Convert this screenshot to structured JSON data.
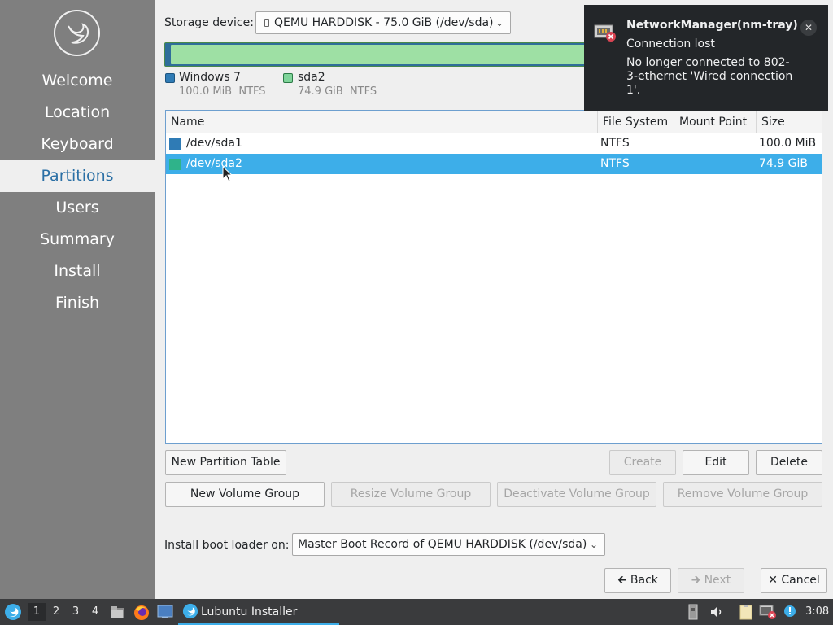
{
  "sidebar": {
    "items": [
      {
        "label": "Welcome",
        "active": false
      },
      {
        "label": "Location",
        "active": false
      },
      {
        "label": "Keyboard",
        "active": false
      },
      {
        "label": "Partitions",
        "active": true
      },
      {
        "label": "Users",
        "active": false
      },
      {
        "label": "Summary",
        "active": false
      },
      {
        "label": "Install",
        "active": false
      },
      {
        "label": "Finish",
        "active": false
      }
    ]
  },
  "storage": {
    "label": "Storage device:",
    "device": "QEMU HARDDISK - 75.0 GiB (/dev/sda)"
  },
  "legend": [
    {
      "name": "Windows 7",
      "size": "100.0 MiB",
      "fs": "NTFS",
      "color": "#2f7bb5"
    },
    {
      "name": "sda2",
      "size": "74.9 GiB",
      "fs": "NTFS",
      "color": "#4cc38a"
    }
  ],
  "table": {
    "headers": {
      "name": "Name",
      "fs": "File System",
      "mount": "Mount Point",
      "size": "Size"
    },
    "rows": [
      {
        "name": "/dev/sda1",
        "fs": "NTFS",
        "mount": "",
        "size": "100.0 MiB",
        "color": "#2f7bb5",
        "selected": false
      },
      {
        "name": "/dev/sda2",
        "fs": "NTFS",
        "mount": "",
        "size": "74.9 GiB",
        "color": "#2fb38a",
        "selected": true
      }
    ]
  },
  "buttons": {
    "new_partition_table": "New Partition Table",
    "create": "Create",
    "edit": "Edit",
    "delete": "Delete",
    "new_volume_group": "New Volume Group",
    "resize_volume_group": "Resize Volume Group",
    "deactivate_volume_group": "Deactivate Volume Group",
    "remove_volume_group": "Remove Volume Group",
    "back": "Back",
    "next": "Next",
    "cancel": "Cancel"
  },
  "bootloader": {
    "label": "Install boot loader on:",
    "value": "Master Boot Record of QEMU HARDDISK (/dev/sda)"
  },
  "notification": {
    "title": "NetworkManager(nm-tray)",
    "summary": "Connection lost",
    "body": "No longer connected to 802-3-ethernet 'Wired connection 1'."
  },
  "taskbar": {
    "workspaces": [
      "1",
      "2",
      "3",
      "4"
    ],
    "active_workspace": "1",
    "task_label": "Lubuntu Installer",
    "clock": "3:08"
  },
  "colors": {
    "accent": "#3daee9",
    "sidebar": "#7f7f7f",
    "active_nav_text": "#2a6fa5"
  }
}
